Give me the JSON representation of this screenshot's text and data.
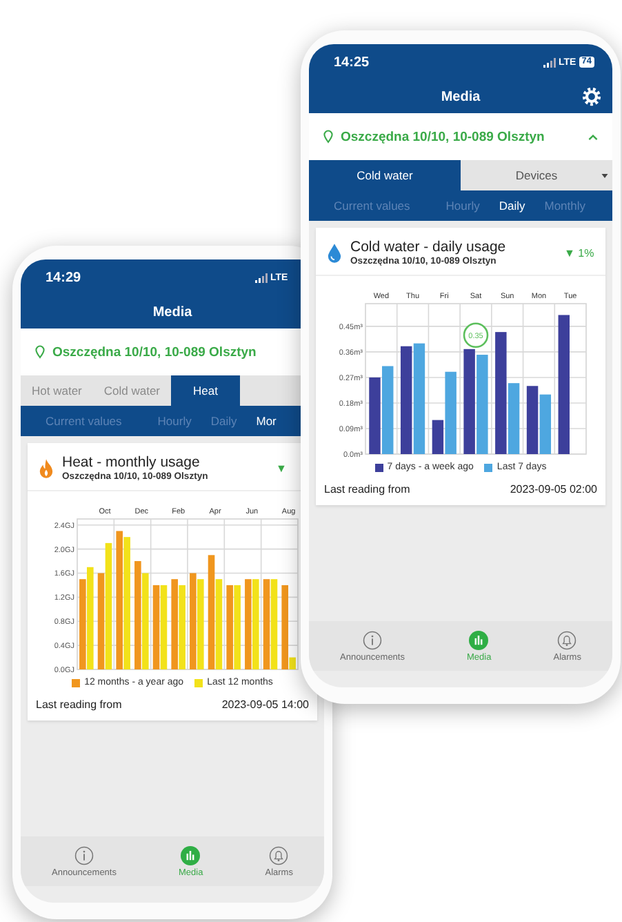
{
  "phones": [
    {
      "status_bar": {
        "time": "14:29",
        "network": "LTE"
      },
      "header": {
        "title": "Media"
      },
      "location": {
        "address": "Oszczędna 10/10, 10-089 Olsztyn"
      },
      "tabs": [
        {
          "label": "Hot water",
          "kind": "tab",
          "selected": false
        },
        {
          "label": "Cold water",
          "kind": "tab",
          "selected": false
        },
        {
          "label": "Heat",
          "kind": "tab",
          "selected": true
        }
      ],
      "subtabs": [
        {
          "label": "Current values",
          "selected": false
        },
        {
          "label": "Hourly",
          "selected": false
        },
        {
          "label": "Daily",
          "selected": false
        },
        {
          "label": "Mor",
          "selected": true
        }
      ],
      "card": {
        "kind": "heat",
        "title": "Heat - monthly usage",
        "subtitle": "Oszczędna 10/10, 10-089 Olsztyn",
        "trend": "▼",
        "chart_data": {
          "type": "bar",
          "categories": [
            null,
            "Oct",
            null,
            "Dec",
            null,
            "Feb",
            null,
            "Apr",
            null,
            "Jun",
            null,
            "Aug"
          ],
          "series": [
            {
              "name": "12 months - a year ago",
              "color": "#f0961e",
              "values": [
                1.5,
                1.6,
                2.3,
                1.8,
                1.4,
                1.5,
                1.6,
                1.9,
                1.4,
                1.5,
                1.5,
                1.4
              ]
            },
            {
              "name": "Last 12 months",
              "color": "#f2e21a",
              "values": [
                1.7,
                2.1,
                2.2,
                1.6,
                1.4,
                1.4,
                1.5,
                1.5,
                1.4,
                1.5,
                1.5,
                0.2
              ]
            }
          ],
          "ylim": [
            0,
            2.5
          ],
          "grid": true,
          "yticks": [
            {
              "value": 0,
              "label": "0.0GJ"
            },
            {
              "value": 0.4,
              "label": "0.4GJ"
            },
            {
              "value": 0.8,
              "label": "0.8GJ"
            },
            {
              "value": 1.2,
              "label": "1.2GJ"
            },
            {
              "value": 1.6,
              "label": "1.6GJ"
            },
            {
              "value": 2.0,
              "label": "2.0GJ"
            },
            {
              "value": 2.4,
              "label": "2.4GJ"
            }
          ]
        },
        "footer_label": "Last reading from",
        "footer_value": "2023-09-05 14:00"
      },
      "nav": [
        {
          "label": "Announcements",
          "selected": false
        },
        {
          "label": "Media",
          "selected": true
        },
        {
          "label": "Alarms",
          "selected": false
        }
      ]
    },
    {
      "status_bar": {
        "time": "14:25",
        "network": "LTE",
        "battery": "74"
      },
      "header": {
        "title": "Media",
        "settings": true
      },
      "location": {
        "address": "Oszczędna 10/10, 10-089 Olsztyn",
        "expanded": true
      },
      "tabs": [
        {
          "label": "Cold water",
          "kind": "tab",
          "selected": true
        },
        {
          "label": "Devices",
          "kind": "dropdown",
          "selected": false
        }
      ],
      "subtabs": [
        {
          "label": "Current values",
          "selected": false
        },
        {
          "label": "Hourly",
          "selected": false
        },
        {
          "label": "Daily",
          "selected": true
        },
        {
          "label": "Monthly",
          "selected": false
        }
      ],
      "card": {
        "kind": "water",
        "title": "Cold water - daily usage",
        "subtitle": "Oszczędna 10/10, 10-089 Olsztyn",
        "trend": "▼ 1%",
        "chart_data": {
          "type": "bar",
          "categories": [
            "Wed",
            "Thu",
            "Fri",
            "Sat",
            "Sun",
            "Mon",
            "Tue"
          ],
          "series": [
            {
              "name": "7 days - a week ago",
              "color": "#3d3f9b",
              "values": [
                0.27,
                0.38,
                0.12,
                0.37,
                0.43,
                0.24,
                0.49
              ]
            },
            {
              "name": "Last 7 days",
              "color": "#4ea7e0",
              "values": [
                0.31,
                0.39,
                0.29,
                0.35,
                0.25,
                0.21,
                null
              ]
            }
          ],
          "ylim": [
            0,
            0.53
          ],
          "grid": true,
          "yticks": [
            {
              "value": 0,
              "label": "0.0m³"
            },
            {
              "value": 0.09,
              "label": "0.09m³"
            },
            {
              "value": 0.18,
              "label": "0.18m³"
            },
            {
              "value": 0.27,
              "label": "0.27m³"
            },
            {
              "value": 0.36,
              "label": "0.36m³"
            },
            {
              "value": 0.45,
              "label": "0.45m³"
            }
          ],
          "annotations": [
            {
              "x": "Sat",
              "y": 0.35,
              "text": "0.35"
            }
          ]
        },
        "footer_label": "Last reading from",
        "footer_value": "2023-09-05 02:00"
      },
      "nav": [
        {
          "label": "Announcements",
          "selected": false
        },
        {
          "label": "Media",
          "selected": true
        },
        {
          "label": "Alarms",
          "selected": false
        }
      ]
    }
  ]
}
